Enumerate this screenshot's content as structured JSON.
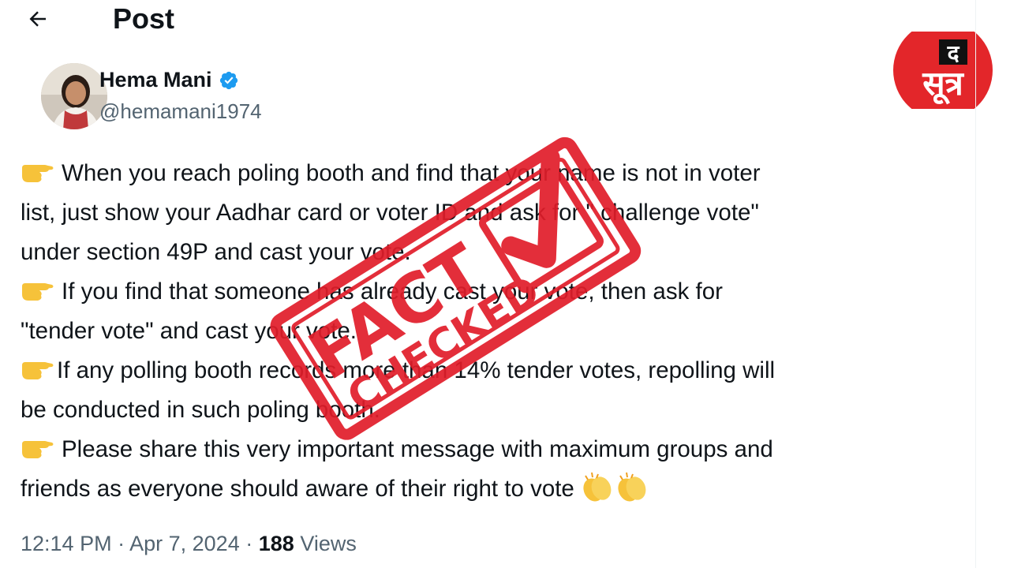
{
  "header": {
    "back_icon": "arrow-left-icon",
    "title": "Post"
  },
  "logo": {
    "top": "द",
    "bottom": "सूत्र",
    "color": "#e3262a"
  },
  "author": {
    "name": "Hema Mani",
    "handle": "@hemamani1974",
    "verified_icon": "verified-badge-icon",
    "verified_color": "#1d9bf0"
  },
  "tweet": {
    "lines": [
      "When you reach poling booth and find that your name is not in voter",
      "list, just show your Aadhar card or voter ID and ask for \" challenge vote\"",
      "under section 49P and cast your vote.",
      "If you find that someone has already cast your vote, then ask for",
      "\"tender vote\" and cast your vote.",
      "If any polling booth records more than 14% tender votes, repolling will",
      "be conducted in such poling booth.",
      "Please share this very important message with maximum groups and",
      "friends as everyone should aware of their right to vote"
    ],
    "emoji_icon": "pointing-hand-emoji",
    "end_icon": "clapping-hands-emoji"
  },
  "meta": {
    "time": "12:14 PM",
    "sep": "·",
    "date": "Apr 7, 2024",
    "views_count": "188",
    "views_label": "Views"
  },
  "stamp": {
    "line1": "FACT",
    "line2": "CHECKED",
    "icon": "checkmark-icon",
    "color": "#e11d2a"
  }
}
